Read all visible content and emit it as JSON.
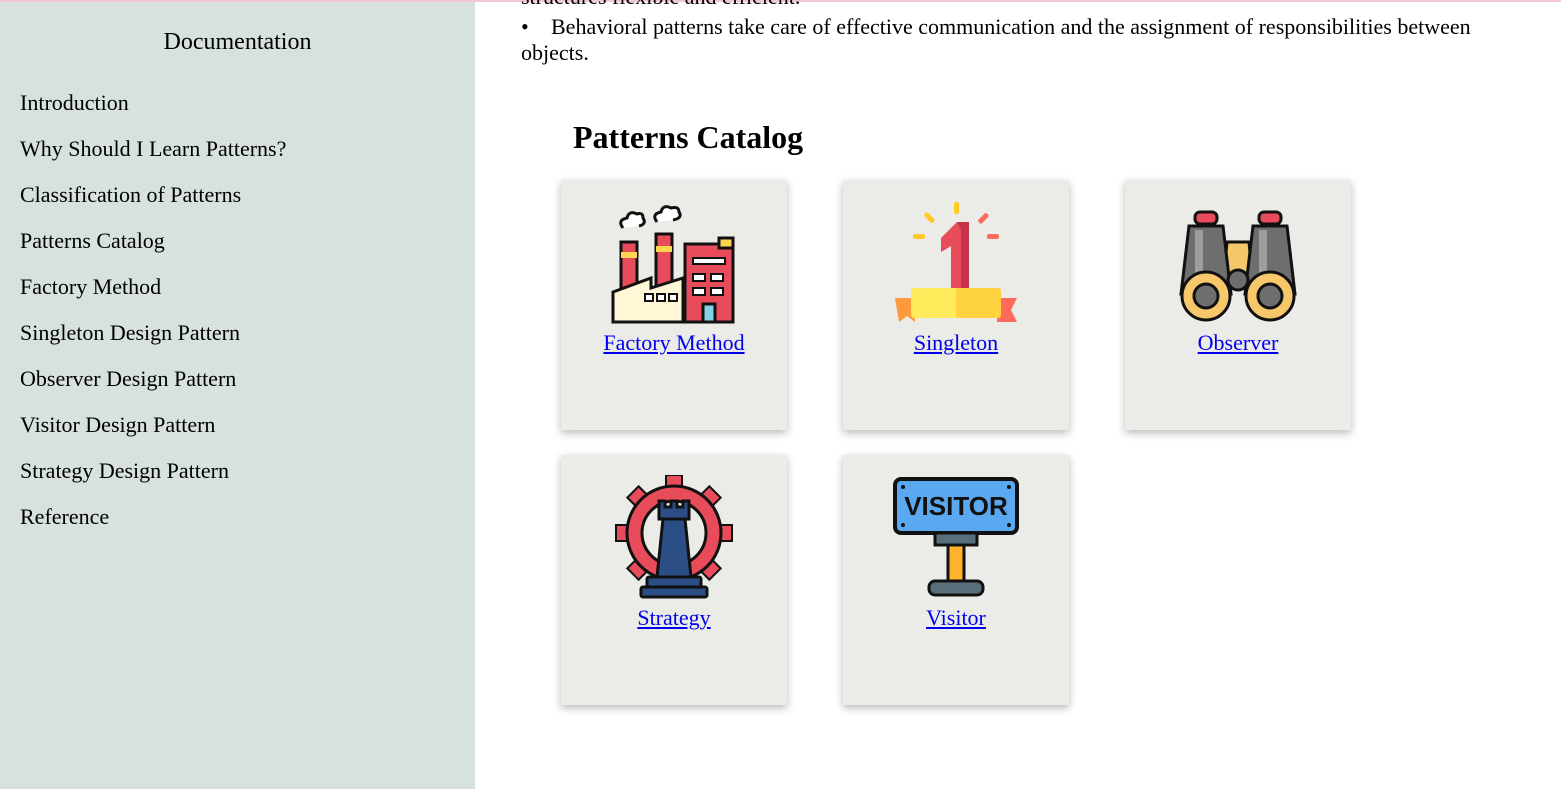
{
  "sidebar": {
    "title": "Documentation",
    "items": [
      {
        "label": "Introduction"
      },
      {
        "label": "Why Should I Learn Patterns?"
      },
      {
        "label": "Classification of Patterns"
      },
      {
        "label": "Patterns Catalog"
      },
      {
        "label": "Factory Method"
      },
      {
        "label": "Singleton Design Pattern"
      },
      {
        "label": "Observer Design Pattern"
      },
      {
        "label": "Visitor Design Pattern"
      },
      {
        "label": "Strategy Design Pattern"
      },
      {
        "label": "Reference"
      }
    ]
  },
  "main": {
    "partial_line": "structures flexible and efficient.",
    "bullet": "Behavioral patterns take care of effective communication and the assignment of responsibilities between",
    "bullet_continuation": "objects.",
    "catalog_title": "Patterns Catalog",
    "cards": [
      {
        "label": "Factory Method",
        "icon": "factory-icon"
      },
      {
        "label": "Singleton",
        "icon": "number-one-icon"
      },
      {
        "label": "Observer",
        "icon": "binoculars-icon"
      },
      {
        "label": "Strategy",
        "icon": "chess-rook-gear-icon"
      },
      {
        "label": "Visitor",
        "icon": "visitor-sign-icon"
      }
    ]
  },
  "colors": {
    "sidebar_bg": "#d7e1dd",
    "card_bg": "#ebebe7",
    "link": "#0000ee"
  }
}
